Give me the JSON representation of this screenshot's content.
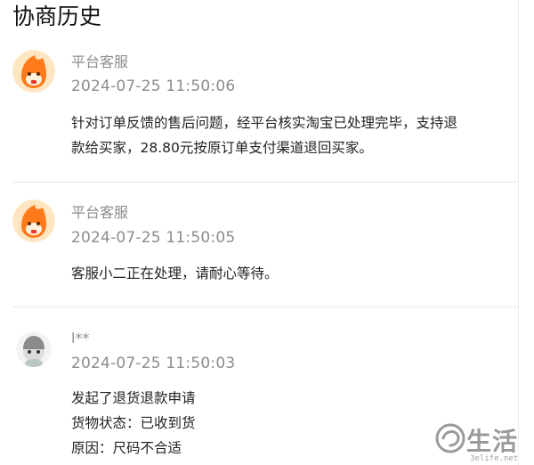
{
  "page": {
    "title": "协商历史"
  },
  "entries": [
    {
      "name": "平台客服",
      "time": "2024-07-25 11:50:06",
      "lines": [
        "针对订单反馈的售后问题，经平台核实淘宝已处理完毕，支持退",
        "款给买家，28.80元按原订单支付渠道退回买家。"
      ]
    },
    {
      "name": "平台客服",
      "time": "2024-07-25 11:50:05",
      "lines": [
        "客服小二正在处理，请耐心等待。"
      ]
    },
    {
      "name": "l**",
      "time": "2024-07-25 11:50:03",
      "lines": [
        "发起了退货退款申请",
        "货物状态：已收到货",
        "原因：尺码不合适"
      ]
    }
  ],
  "watermark": {
    "text": "生活",
    "sub": "3elife.net"
  }
}
